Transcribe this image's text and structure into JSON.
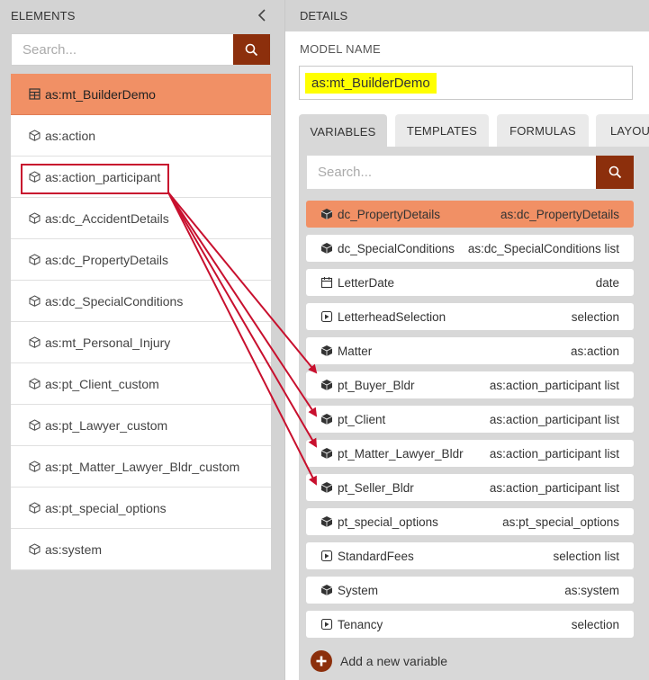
{
  "left": {
    "header": "ELEMENTS",
    "search_placeholder": "Search...",
    "items": [
      {
        "label": "as:mt_BuilderDemo",
        "icon": "model-icon"
      },
      {
        "label": "as:action",
        "icon": "cube-icon"
      },
      {
        "label": "as:action_participant",
        "icon": "cube-icon"
      },
      {
        "label": "as:dc_AccidentDetails",
        "icon": "cube-icon"
      },
      {
        "label": "as:dc_PropertyDetails",
        "icon": "cube-icon"
      },
      {
        "label": "as:dc_SpecialConditions",
        "icon": "cube-icon"
      },
      {
        "label": "as:mt_Personal_Injury",
        "icon": "cube-icon"
      },
      {
        "label": "as:pt_Client_custom",
        "icon": "cube-icon"
      },
      {
        "label": "as:pt_Lawyer_custom",
        "icon": "cube-icon"
      },
      {
        "label": "as:pt_Matter_Lawyer_Bldr_custom",
        "icon": "cube-icon"
      },
      {
        "label": "as:pt_special_options",
        "icon": "cube-icon"
      },
      {
        "label": "as:system",
        "icon": "cube-icon"
      }
    ]
  },
  "details": {
    "header": "DETAILS",
    "model_name_label": "MODEL NAME",
    "model_name_value": "as:mt_BuilderDemo",
    "tabs": [
      "VARIABLES",
      "TEMPLATES",
      "FORMULAS",
      "LAYOU"
    ],
    "active_tab": "VARIABLES",
    "search_placeholder": "Search...",
    "variables": [
      {
        "name": "dc_PropertyDetails",
        "type": "as:dc_PropertyDetails",
        "icon": "cube-filled-icon"
      },
      {
        "name": "dc_SpecialConditions",
        "type": "as:dc_SpecialConditions list",
        "icon": "cube-filled-icon"
      },
      {
        "name": "LetterDate",
        "type": "date",
        "icon": "calendar-icon"
      },
      {
        "name": "LetterheadSelection",
        "type": "selection",
        "icon": "selection-icon"
      },
      {
        "name": "Matter",
        "type": "as:action",
        "icon": "cube-filled-icon"
      },
      {
        "name": "pt_Buyer_Bldr",
        "type": "as:action_participant list",
        "icon": "cube-filled-icon"
      },
      {
        "name": "pt_Client",
        "type": "as:action_participant list",
        "icon": "cube-filled-icon"
      },
      {
        "name": "pt_Matter_Lawyer_Bldr",
        "type": "as:action_participant list",
        "icon": "cube-filled-icon"
      },
      {
        "name": "pt_Seller_Bldr",
        "type": "as:action_participant list",
        "icon": "cube-filled-icon"
      },
      {
        "name": "pt_special_options",
        "type": "as:pt_special_options",
        "icon": "cube-filled-icon"
      },
      {
        "name": "StandardFees",
        "type": "selection list",
        "icon": "selection-icon"
      },
      {
        "name": "System",
        "type": "as:system",
        "icon": "cube-filled-icon"
      },
      {
        "name": "Tenancy",
        "type": "selection",
        "icon": "selection-icon"
      }
    ],
    "add_variable_label": "Add a new variable"
  },
  "colors": {
    "accent": "#8c2f0c",
    "selected": "#f19065",
    "highlight": "#ffff00",
    "annotation": "#c8102e"
  }
}
